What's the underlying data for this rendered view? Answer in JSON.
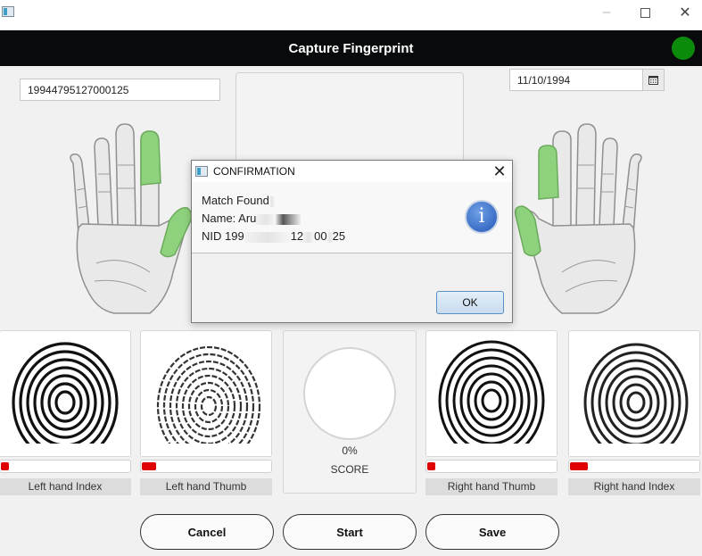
{
  "window": {
    "app_icon": "app-icon",
    "minimize": "–",
    "maximize_icon": "maximize-icon",
    "close": "✕"
  },
  "header": {
    "title": "Capture Fingerprint",
    "status_color": "#0c8a0c"
  },
  "form": {
    "nid_value": "19944795127000125",
    "date_value": "11/10/1994",
    "calendar_icon": "calendar-icon"
  },
  "fingers": [
    {
      "label": "Left hand Index",
      "quality": 0.06
    },
    {
      "label": "Left hand Thumb",
      "quality": 0.11
    },
    {
      "label": "Right hand Thumb",
      "quality": 0.06
    },
    {
      "label": "Right hand Index",
      "quality": 0.14
    }
  ],
  "score": {
    "value": "0%",
    "label": "SCORE"
  },
  "actions": {
    "cancel": "Cancel",
    "start": "Start",
    "save": "Save"
  },
  "dialog": {
    "title": "CONFIRMATION",
    "close": "✕",
    "line1": "Match Found",
    "line2_prefix": "Name: Aru",
    "line3_prefix": "NID 199",
    "line3_mid": "12",
    "line3_mid2": "00",
    "line3_end": "25",
    "icon_glyph": "i",
    "ok": "OK"
  },
  "colors": {
    "highlight_finger": "#8fd27e",
    "quality_bar": "#e00000",
    "header_bg": "#080a0b"
  }
}
